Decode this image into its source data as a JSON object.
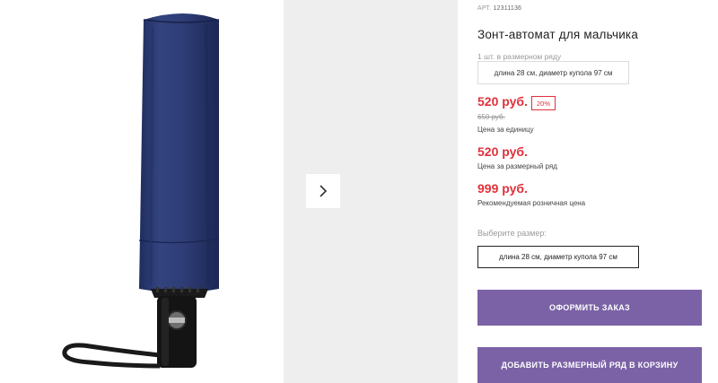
{
  "gallery": {
    "product_image": "umbrella-folded-navy-photo",
    "next_icon": "chevron-right-icon"
  },
  "product": {
    "sku_prefix": "АРТ.",
    "sku_number": "12311136",
    "title": "Зонт-автомат для мальчика",
    "pack_label": "1 шт. в размерном ряду",
    "pack_option": "длина 28 см, диаметр купола 97 см"
  },
  "pricing": {
    "unit_price": "520 руб.",
    "discount_badge": "20%",
    "old_price": "650 руб.",
    "unit_caption": "Цена за единицу",
    "row_price": "520 руб.",
    "row_caption": "Цена за размерный ряд",
    "retail_price": "999 руб.",
    "retail_caption": "Рекомендуемая розничная цена"
  },
  "size_select": {
    "label": "Выберите размер:",
    "selected_option": "длина 28 см, диаметр купола 97 см"
  },
  "actions": {
    "order_label": "ОФОРМИТЬ ЗАКАЗ",
    "add_row_label": "ДОБАВИТЬ РАЗМЕРНЫЙ РЯД В КОРЗИНУ"
  },
  "colors": {
    "price_red": "#e0303a",
    "button_purple": "#7b62a6",
    "umbrella_navy": "#2c3a72"
  }
}
